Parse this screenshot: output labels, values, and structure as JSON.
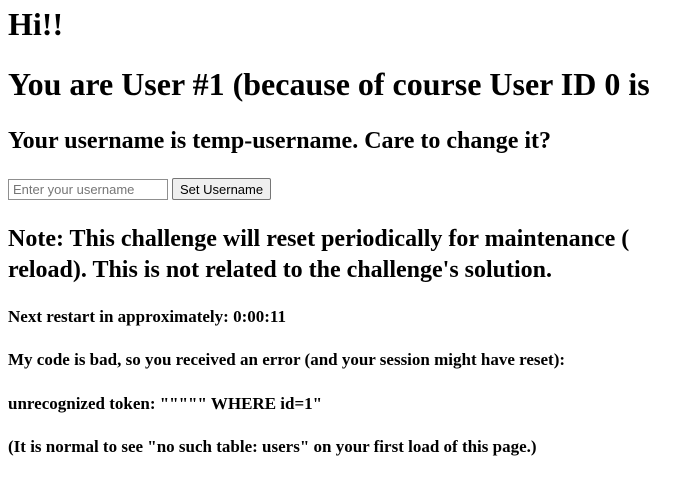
{
  "greeting": "Hi!!",
  "user_line": "You are User #1 (because of course User ID 0 is",
  "username_line": "Your username is temp-username. Care to change it?",
  "form": {
    "username_placeholder": "Enter your username",
    "username_value": "",
    "submit_label": "Set Username"
  },
  "note_line1": "Note: This challenge will reset periodically for maintenance (",
  "note_line2": "reload). This is not related to the challenge's solution.",
  "restart": {
    "label": "Next restart in approximately:",
    "time": "0:00:11"
  },
  "error_intro": "My code is bad, so you received an error (and your session might have reset):",
  "error_message": "unrecognized token: \"\"\"\"\" WHERE id=1\"",
  "hint": "(It is normal to see \"no such table: users\" on your first load of this page.)"
}
